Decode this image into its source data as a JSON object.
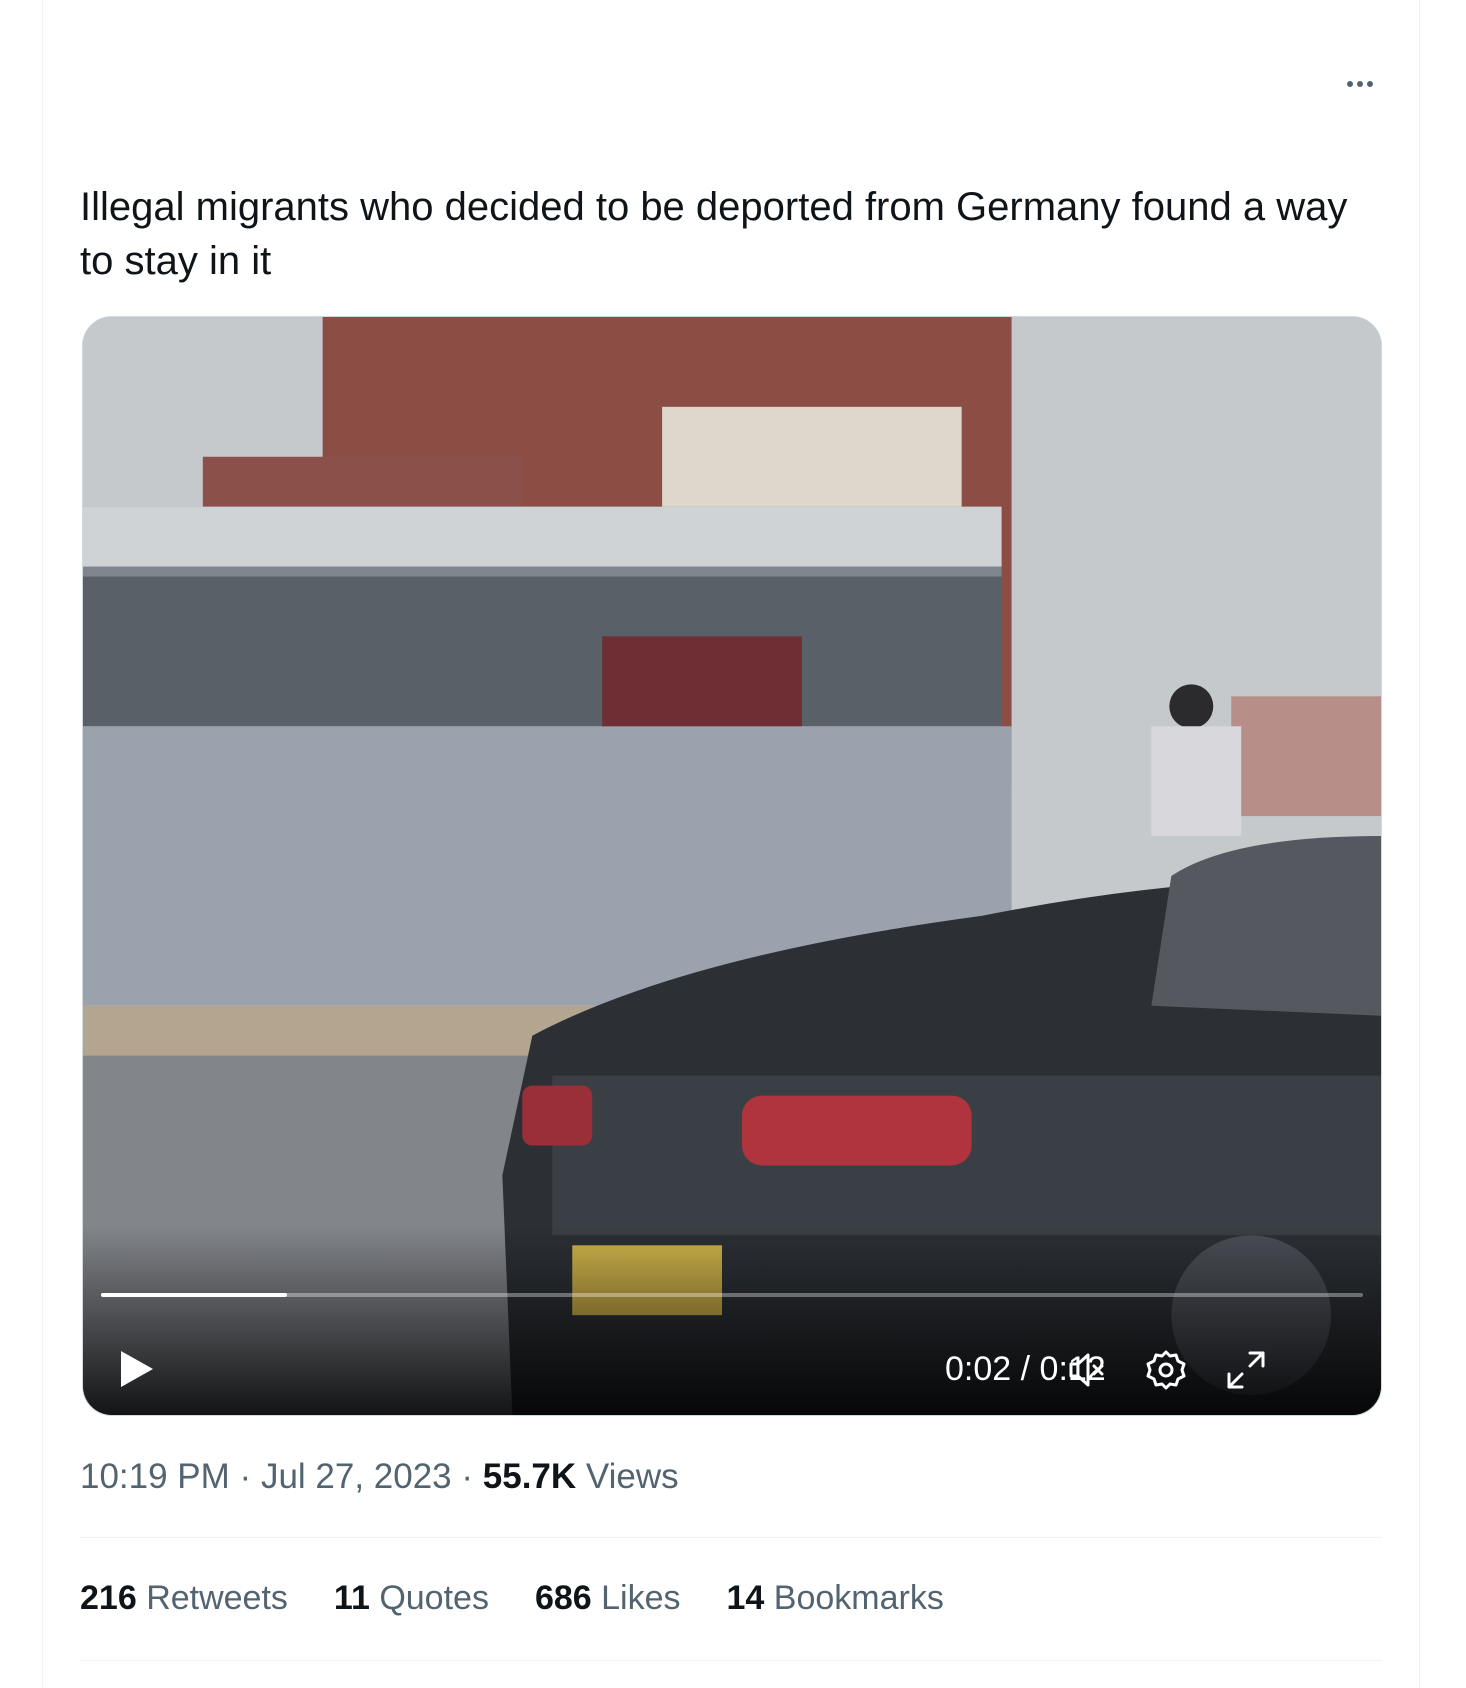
{
  "tweet": {
    "text": "Illegal migrants who decided to be deported from Germany found a way to stay in it",
    "time": "10:19 PM",
    "date": "Jul 27, 2023",
    "views_count": "55.7K",
    "views_label": "Views",
    "separator": "·"
  },
  "video": {
    "current_time": "0:02",
    "duration": "0:12",
    "time_separator": "/",
    "progress_fraction": 0.147
  },
  "stats": [
    {
      "count": "216",
      "label": "Retweets"
    },
    {
      "count": "11",
      "label": "Quotes"
    },
    {
      "count": "686",
      "label": "Likes"
    },
    {
      "count": "14",
      "label": "Bookmarks"
    }
  ],
  "icons": {
    "more": "more-options-icon",
    "play": "play-icon",
    "mute": "volume-muted-icon",
    "settings": "gear-icon",
    "fullscreen": "fullscreen-icon"
  }
}
